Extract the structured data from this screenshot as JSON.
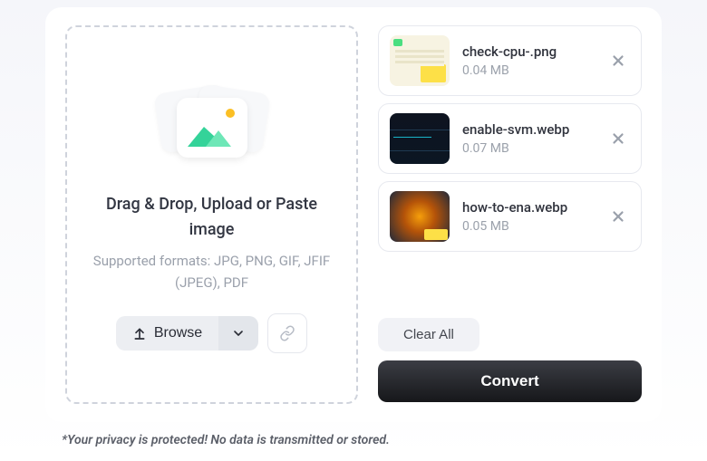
{
  "dropzone": {
    "title": "Drag & Drop, Upload or Paste image",
    "subtitle": "Supported formats: JPG, PNG, GIF, JFIF (JPEG), PDF",
    "browse_label": "Browse"
  },
  "files": [
    {
      "name": "check-cpu-.png",
      "size": "0.04 MB"
    },
    {
      "name": "enable-svm.webp",
      "size": "0.07 MB"
    },
    {
      "name": "how-to-ena.webp",
      "size": "0.05 MB"
    }
  ],
  "actions": {
    "clear_label": "Clear All",
    "convert_label": "Convert"
  },
  "privacy_note": "*Your privacy is protected! No data is transmitted or stored."
}
